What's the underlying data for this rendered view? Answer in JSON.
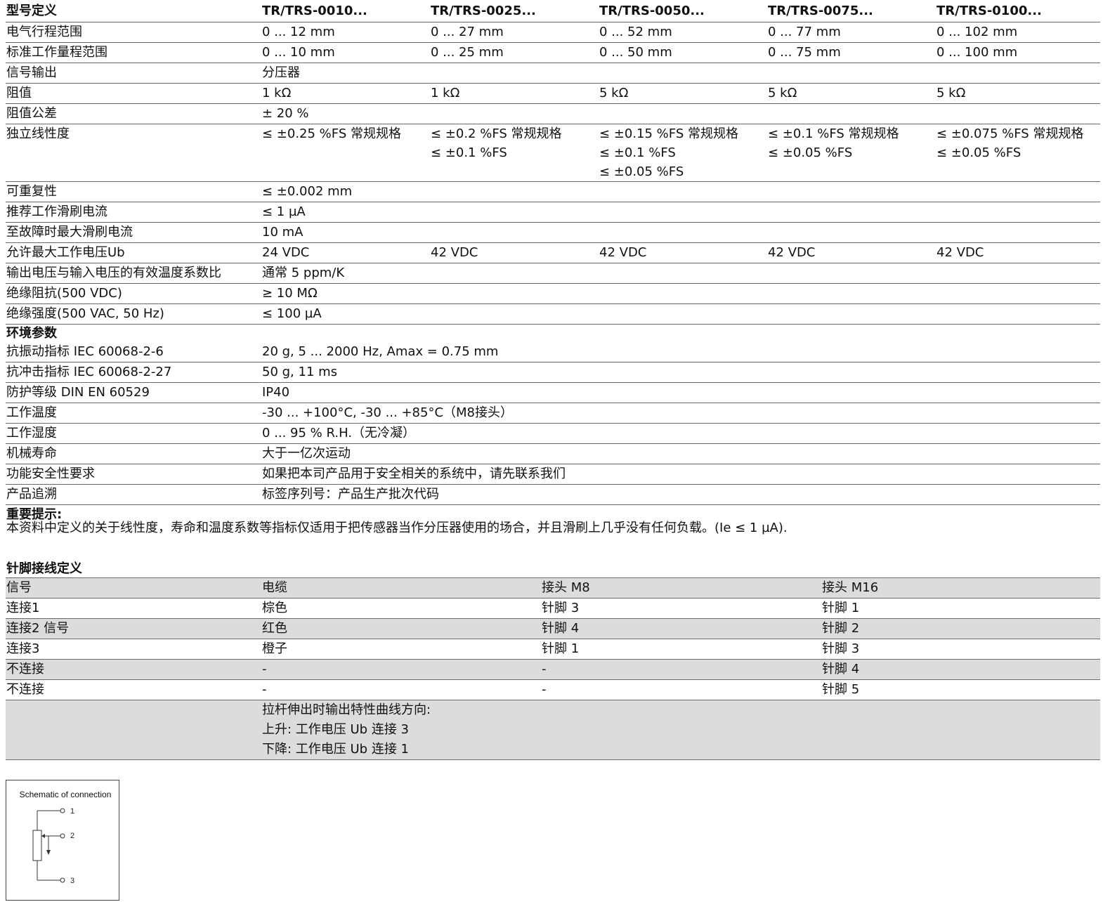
{
  "specs": {
    "header": [
      "型号定义",
      "TR/TRS-0010...",
      "TR/TRS-0025...",
      "TR/TRS-0050...",
      "TR/TRS-0075...",
      "TR/TRS-0100..."
    ],
    "rows": [
      {
        "label": "电气行程范围",
        "cells": [
          [
            "0 ... 12 mm"
          ],
          [
            "0 ... 27 mm"
          ],
          [
            "0 ... 52 mm"
          ],
          [
            "0 ... 77 mm"
          ],
          [
            "0 ... 102 mm"
          ]
        ]
      },
      {
        "label": "标准工作量程范围",
        "cells": [
          [
            "0 ... 10 mm"
          ],
          [
            "0 ... 25 mm"
          ],
          [
            "0 ... 50 mm"
          ],
          [
            "0 ... 75 mm"
          ],
          [
            "0 ... 100 mm"
          ]
        ]
      },
      {
        "label": "信号输出",
        "cells": [
          [
            "分压器"
          ],
          [],
          [],
          [],
          []
        ]
      },
      {
        "label": "阻值",
        "cells": [
          [
            "1 kΩ"
          ],
          [
            "1 kΩ"
          ],
          [
            "5 kΩ"
          ],
          [
            "5 kΩ"
          ],
          [
            "5 kΩ"
          ]
        ]
      },
      {
        "label": "阻值公差",
        "cells": [
          [
            "± 20 %"
          ],
          [],
          [],
          [],
          []
        ]
      },
      {
        "label": "独立线性度",
        "cells": [
          [
            "≤ ±0.25 %FS 常规规格"
          ],
          [
            "≤ ±0.2 %FS 常规规格",
            "≤ ±0.1 %FS"
          ],
          [
            "≤ ±0.15 %FS 常规规格",
            "≤ ±0.1 %FS",
            "≤ ±0.05 %FS"
          ],
          [
            "≤ ±0.1 %FS 常规规格",
            "≤ ±0.05 %FS"
          ],
          [
            "≤ ±0.075 %FS 常规规格",
            "≤ ±0.05 %FS"
          ]
        ]
      },
      {
        "label": "可重复性",
        "cells": [
          [
            "≤ ±0.002 mm"
          ],
          [],
          [],
          [],
          []
        ]
      },
      {
        "label": "推荐工作滑刷电流",
        "cells": [
          [
            "≤ 1 µA"
          ],
          [],
          [],
          [],
          []
        ]
      },
      {
        "label": "至故障时最大滑刷电流",
        "cells": [
          [
            "10 mA"
          ],
          [],
          [],
          [],
          []
        ]
      },
      {
        "label": "允许最大工作电压Ub",
        "cells": [
          [
            "24 VDC"
          ],
          [
            "42 VDC"
          ],
          [
            "42 VDC"
          ],
          [
            "42 VDC"
          ],
          [
            "42 VDC"
          ]
        ]
      },
      {
        "label": "输出电压与输入电压的有效温度系数比",
        "cells": [
          [
            "通常 5 ppm/K"
          ],
          [],
          [],
          [],
          []
        ]
      },
      {
        "label": "绝缘阻抗(500 VDC)",
        "cells": [
          [
            "≥ 10 MΩ"
          ],
          [],
          [],
          [],
          []
        ]
      },
      {
        "label": "绝缘强度(500 VAC, 50 Hz)",
        "cells": [
          [
            "≤ 100 µA"
          ],
          [],
          [],
          [],
          []
        ]
      }
    ],
    "section": "环境参数",
    "env_rows": [
      {
        "label": "抗振动指标 IEC 60068-2-6",
        "cells": [
          [
            "20 g, 5 ... 2000 Hz, Amax = 0.75 mm"
          ],
          [],
          [],
          [],
          []
        ]
      },
      {
        "label": "抗冲击指标 IEC 60068-2-27",
        "cells": [
          [
            "50 g, 11 ms"
          ],
          [],
          [],
          [],
          []
        ]
      },
      {
        "label": "防护等级 DIN EN 60529",
        "cells": [
          [
            "IP40"
          ],
          [],
          [],
          [],
          []
        ]
      },
      {
        "label": "工作温度",
        "cells": [
          [
            "-30 ... +100°C, -30 ... +85°C（M8接头）"
          ],
          [],
          [],
          [],
          []
        ]
      },
      {
        "label": "工作湿度",
        "cells": [
          [
            "0 ... 95 % R.H.（无冷凝）"
          ],
          [],
          [],
          [],
          []
        ]
      },
      {
        "label": "机械寿命",
        "cells": [
          [
            "大于一亿次运动"
          ],
          [],
          [],
          [],
          []
        ]
      },
      {
        "label": "功能安全性要求",
        "cells": [
          [
            "如果把本司产品用于安全相关的系统中，请先联系我们"
          ],
          [],
          [],
          [],
          []
        ]
      },
      {
        "label": "产品追溯",
        "cells": [
          [
            "标签序列号：产品生产批次代码"
          ],
          [],
          [],
          [],
          []
        ]
      }
    ]
  },
  "note": {
    "title": "重要提示:",
    "text": "本资料中定义的关于线性度，寿命和温度系数等指标仅适用于把传感器当作分压器使用的场合，并且滑刷上几乎没有任何负载。(Ie ≤ 1 µA)."
  },
  "pins": {
    "title": "针脚接线定义",
    "rows": [
      [
        [
          "信号"
        ],
        [
          "电缆"
        ],
        [
          "接头 M8"
        ],
        [
          "接头 M16"
        ]
      ],
      [
        [
          "连接1"
        ],
        [
          "棕色"
        ],
        [
          "针脚 3"
        ],
        [
          "针脚 1"
        ]
      ],
      [
        [
          "连接2 信号"
        ],
        [
          "红色"
        ],
        [
          "针脚 4"
        ],
        [
          "针脚 2"
        ]
      ],
      [
        [
          "连接3"
        ],
        [
          "橙子"
        ],
        [
          "针脚 1"
        ],
        [
          "针脚 3"
        ]
      ],
      [
        [
          "不连接"
        ],
        [
          "-"
        ],
        [
          "-"
        ],
        [
          "针脚 4"
        ]
      ],
      [
        [
          "不连接"
        ],
        [
          "-"
        ],
        [
          "-"
        ],
        [
          "针脚 5"
        ]
      ],
      [
        [],
        [
          "拉杆伸出时输出特性曲线方向:",
          "上升: 工作电压 Ub 连接 3",
          "下降: 工作电压 Ub 连接 1"
        ],
        [],
        []
      ]
    ],
    "shaded_rows": [
      0,
      2,
      4,
      6
    ]
  },
  "schematic": {
    "title": "Schematic of connection",
    "terminals": [
      "1",
      "2",
      "3"
    ]
  }
}
